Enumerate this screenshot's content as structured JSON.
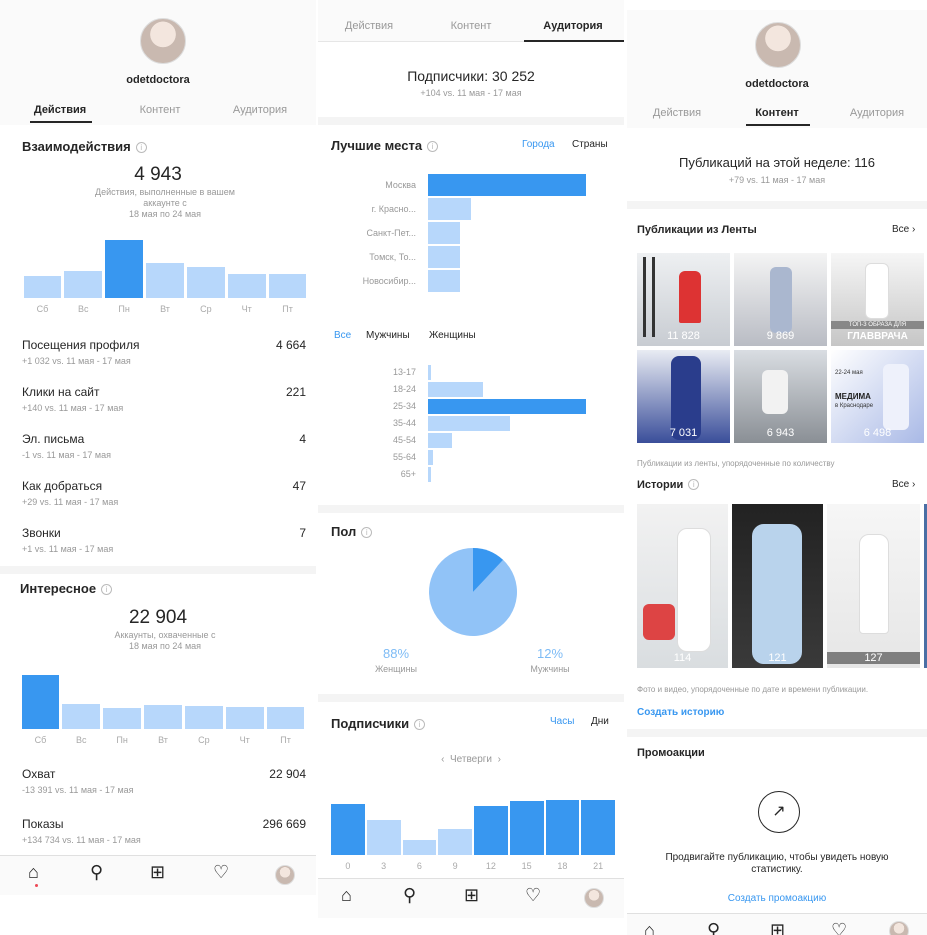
{
  "p1": {
    "username": "odetdoctora",
    "tabs": [
      "Действия",
      "Контент",
      "Аудитория"
    ],
    "interactions": {
      "title": "Взаимодействия",
      "total": "4 943",
      "desc": "Действия, выполненные в вашем аккаунте с",
      "range": "18 мая по 24 мая"
    },
    "chart1": {
      "type": "bar",
      "categories": [
        "Сб",
        "Вс",
        "Пн",
        "Вт",
        "Ср",
        "Чт",
        "Пт"
      ],
      "values": [
        0.38,
        0.46,
        1.0,
        0.6,
        0.53,
        0.42,
        0.42
      ],
      "highlight": 2
    },
    "rows": [
      {
        "label": "Посещения профиля",
        "value": "4 664",
        "sub": "+1 032 vs. 11 мая - 17 мая"
      },
      {
        "label": "Клики на сайт",
        "value": "221",
        "sub": "+140 vs. 11 мая - 17 мая"
      },
      {
        "label": "Эл. письма",
        "value": "4",
        "sub": "-1 vs. 11 мая - 17 мая"
      },
      {
        "label": "Как добраться",
        "value": "47",
        "sub": "+29 vs. 11 мая - 17 мая"
      },
      {
        "label": "Звонки",
        "value": "7",
        "sub": "+1 vs. 11 мая - 17 мая"
      }
    ],
    "discovery": {
      "title": "Интересное",
      "total": "22 904",
      "desc": "Аккаунты, охваченные с",
      "range": "18 мая по 24 мая"
    },
    "chart2": {
      "type": "bar",
      "categories": [
        "Сб",
        "Вс",
        "Пн",
        "Вт",
        "Ср",
        "Чт",
        "Пт"
      ],
      "values": [
        1.0,
        0.46,
        0.38,
        0.44,
        0.43,
        0.41,
        0.41
      ],
      "highlight": 0
    },
    "rows2": [
      {
        "label": "Охват",
        "value": "22 904",
        "sub": "-13 391 vs. 11 мая - 17 мая"
      },
      {
        "label": "Показы",
        "value": "296 669",
        "sub": "+134 734 vs. 11 мая - 17 мая"
      }
    ]
  },
  "p2": {
    "tabs": [
      "Действия",
      "Контент",
      "Аудитория"
    ],
    "followers": "Подписчики: 30 252",
    "followers_sub": "+104 vs. 11 мая - 17 мая",
    "places": {
      "title": "Лучшие места",
      "opt_cities": "Города",
      "opt_countries": "Страны"
    },
    "chart_places": {
      "type": "bar",
      "categories": [
        "Москва",
        "г. Красно...",
        "Санкт-Пет...",
        "Томск, То...",
        "Новосибир..."
      ],
      "values": [
        1.0,
        0.27,
        0.2,
        0.2,
        0.2
      ]
    },
    "gender_tabs": [
      "Все",
      "Мужчины",
      "Женщины"
    ],
    "chart_age": {
      "type": "bar",
      "categories": [
        "13-17",
        "18-24",
        "25-34",
        "35-44",
        "45-54",
        "55-64",
        "65+"
      ],
      "values": [
        0.02,
        0.35,
        1.0,
        0.52,
        0.15,
        0.03,
        0.02
      ]
    },
    "gender": {
      "title": "Пол",
      "women_pct": "88%",
      "women_label": "Женщины",
      "men_pct": "12%",
      "men_label": "Мужчины"
    },
    "chart_gender": {
      "type": "pie",
      "categories": [
        "Женщины",
        "Мужчины"
      ],
      "values": [
        88,
        12
      ]
    },
    "followers_time": {
      "title": "Подписчики",
      "opt_hours": "Часы",
      "opt_days": "Дни",
      "day": "Четверги"
    },
    "chart_hours": {
      "type": "bar",
      "categories": [
        "0",
        "3",
        "6",
        "9",
        "12",
        "15",
        "18",
        "21"
      ],
      "values": [
        0.62,
        0.42,
        0.18,
        0.31,
        0.6,
        0.65,
        0.67,
        0.67
      ]
    }
  },
  "p3": {
    "username": "odetdoctora",
    "tabs": [
      "Действия",
      "Контент",
      "Аудитория"
    ],
    "week": "Публикаций на этой неделе: 116",
    "week_sub": "+79 vs. 11 мая - 17 мая",
    "feed": {
      "title": "Публикации из Ленты",
      "all": "Все ›",
      "note": "Публикации из ленты, упорядоченные по количеству",
      "thumbs": [
        "11 828",
        "9 869",
        "",
        "7 031",
        "6 943",
        "6 498"
      ]
    },
    "overlay": {
      "t1": "ТОП-3 ОБРАЗА ДЛЯ",
      "t2": "ГЛАВВРАЧА",
      "t3": "22-24 мая",
      "t4": "МЕДИМА",
      "t5": "в Краснодаре"
    },
    "stories": {
      "title": "Истории",
      "all": "Все ›",
      "nums": [
        "114",
        "121",
        "127"
      ],
      "note": "Фото и видео, упорядоченные по дате и времени публикации.",
      "create": "Создать историю"
    },
    "promos": {
      "title": "Промоакции",
      "text": "Продвигайте публикацию, чтобы увидеть новую статистику.",
      "create": "Создать промоакцию"
    }
  },
  "colors": {
    "accent": "#3897f0",
    "bar_light": "#b7d7fb"
  }
}
